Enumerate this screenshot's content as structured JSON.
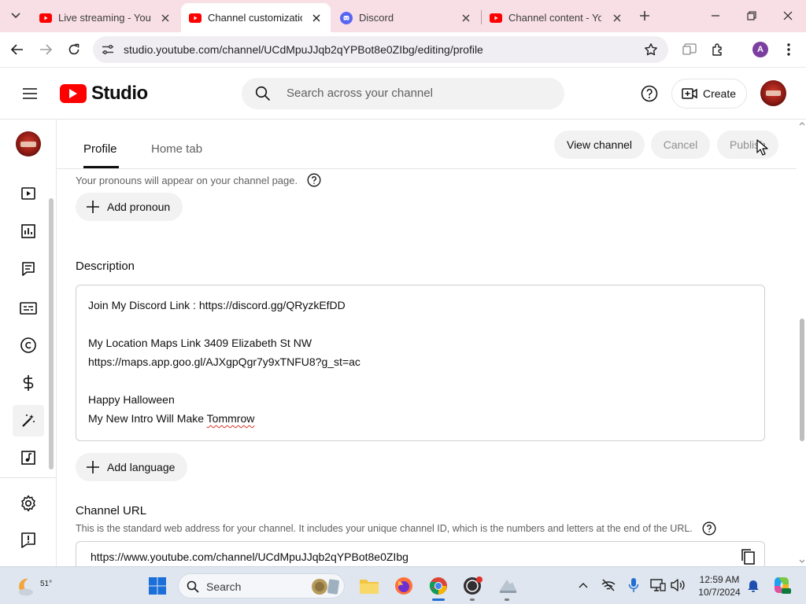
{
  "browser": {
    "tabs": [
      {
        "title": "Live streaming - YouTube",
        "favicon": "youtube-icon",
        "active": false
      },
      {
        "title": "Channel customization",
        "favicon": "youtube-icon",
        "active": true
      },
      {
        "title": "Discord",
        "favicon": "discord-icon",
        "active": false
      },
      {
        "title": "Channel content - YouTube",
        "favicon": "youtube-icon",
        "active": false
      }
    ],
    "url": "studio.youtube.com/channel/UCdMpuJJqb2qYPBot8e0ZIbg/editing/profile",
    "profile_initial": "A",
    "accent": "#f8dfe6"
  },
  "studio": {
    "logo_text": "Studio",
    "search_placeholder": "Search across your channel",
    "create_label": "Create",
    "brand_red": "#ff0000"
  },
  "rail": {
    "items": [
      {
        "name": "content-icon"
      },
      {
        "name": "analytics-icon"
      },
      {
        "name": "comments-icon"
      },
      {
        "name": "subtitles-icon"
      },
      {
        "name": "copyright-icon"
      },
      {
        "name": "earn-icon"
      },
      {
        "name": "customization-icon",
        "active": true
      },
      {
        "name": "audio-library-icon"
      }
    ],
    "bottom": [
      {
        "name": "settings-icon"
      },
      {
        "name": "feedback-icon"
      }
    ]
  },
  "page": {
    "tabs": [
      {
        "label": "Profile",
        "active": true
      },
      {
        "label": "Home tab",
        "active": false
      }
    ],
    "view_channel_label": "View channel",
    "cancel_label": "Cancel",
    "publish_label": "Publish",
    "pronoun_hint": "Your pronouns will appear on your channel page.",
    "add_pronoun_label": "Add pronoun",
    "description_title": "Description",
    "description_lines": [
      "Join My Discord Link :  https://discord.gg/QRyzkEfDD",
      "",
      "My Location Maps Link 3409 Elizabeth St NW",
      "https://maps.app.goo.gl/AJXgpQgr7y9xTNFU8?g_st=ac",
      "",
      "Happy Halloween",
      "My New Intro Will Make "
    ],
    "description_misspelled": "Tommrow",
    "add_language_label": "Add language",
    "channel_url_title": "Channel URL",
    "channel_url_hint": "This is the standard web address for your channel. It includes your unique channel ID, which is the numbers and letters at the end of the URL.",
    "channel_url": "https://www.youtube.com/channel/UCdMpuJJqb2qYPBot8e0ZIbg"
  },
  "taskbar": {
    "weather_temp": "51°",
    "search_label": "Search",
    "time": "12:59 AM",
    "date": "10/7/2024"
  }
}
